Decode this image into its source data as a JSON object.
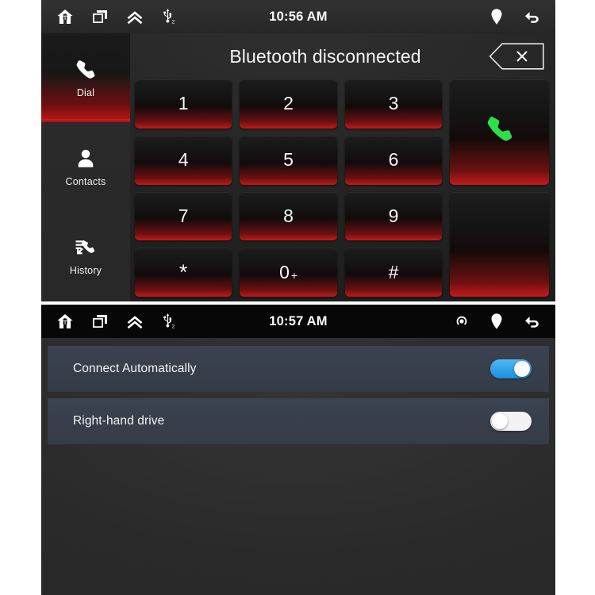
{
  "dialer": {
    "status_bar": {
      "time": "10:56 AM",
      "left_icons": [
        "home-icon",
        "recent-apps-icon",
        "chevron-up-double-icon",
        "usb2-icon"
      ],
      "right_icons": [
        "location-pin-icon",
        "back-arrow-icon"
      ]
    },
    "title": "Bluetooth disconnected",
    "delete_button": "delete-backspace-button",
    "sidebar": {
      "items": [
        {
          "label": "Dial",
          "icon": "phone-icon",
          "active": true
        },
        {
          "label": "Contacts",
          "icon": "person-icon",
          "active": false
        },
        {
          "label": "History",
          "icon": "call-history-icon",
          "active": false
        }
      ]
    },
    "keypad": {
      "keys": [
        {
          "label": "1",
          "sup": ""
        },
        {
          "label": "2",
          "sup": ""
        },
        {
          "label": "3",
          "sup": ""
        },
        {
          "label": "4",
          "sup": ""
        },
        {
          "label": "5",
          "sup": ""
        },
        {
          "label": "6",
          "sup": ""
        },
        {
          "label": "7",
          "sup": ""
        },
        {
          "label": "8",
          "sup": ""
        },
        {
          "label": "9",
          "sup": ""
        },
        {
          "label": "*",
          "sup": ""
        },
        {
          "label": "0",
          "sup": "+"
        },
        {
          "label": "#",
          "sup": ""
        }
      ],
      "call_button": "call-button",
      "blank_button": "blank-button"
    }
  },
  "settings": {
    "status_bar": {
      "time": "10:57 AM",
      "left_icons": [
        "home-icon",
        "recent-apps-icon",
        "chevron-up-double-icon",
        "usb2-icon"
      ],
      "right_icons": [
        "cast-icon",
        "location-pin-icon",
        "back-arrow-icon"
      ]
    },
    "rows": [
      {
        "label": "Connect Automatically",
        "toggle": "on"
      },
      {
        "label": "Right-hand drive",
        "toggle": "off"
      }
    ]
  },
  "colors": {
    "accent_red": "#c21a1a",
    "call_green": "#2de04a",
    "toggle_on_blue": "#1b8fe0",
    "row_slate": "#3b4250"
  }
}
